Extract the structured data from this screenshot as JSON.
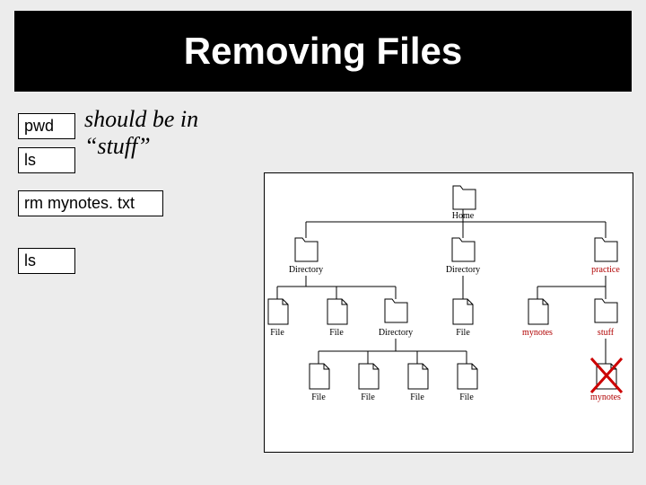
{
  "title": "Removing Files",
  "note_line1": "should be in",
  "note_line2": "“stuff”",
  "commands": {
    "c1": "pwd",
    "c2": "ls",
    "c3": "rm   mynotes. txt",
    "c4": "ls"
  },
  "tree": {
    "home": "Home",
    "dir1": "Directory",
    "dir2": "Directory",
    "practice": "practice",
    "file_a": "File",
    "file_b": "File",
    "dir3": "Directory",
    "file_c": "File",
    "mynotes1": "mynotes",
    "stuff": "stuff",
    "file_d": "File",
    "file_e": "File",
    "file_f": "File",
    "file_g": "File",
    "mynotes2": "mynotes"
  },
  "chart_data": {
    "type": "tree",
    "root": "Home",
    "children": [
      {
        "name": "Directory",
        "type": "folder",
        "children": [
          {
            "name": "File",
            "type": "file"
          },
          {
            "name": "File",
            "type": "file"
          },
          {
            "name": "Directory",
            "type": "folder",
            "children": [
              {
                "name": "File",
                "type": "file"
              },
              {
                "name": "File",
                "type": "file"
              },
              {
                "name": "File",
                "type": "file"
              },
              {
                "name": "File",
                "type": "file"
              }
            ]
          }
        ]
      },
      {
        "name": "Directory",
        "type": "folder",
        "children": [
          {
            "name": "File",
            "type": "file"
          }
        ]
      },
      {
        "name": "practice",
        "type": "folder",
        "color": "red",
        "children": [
          {
            "name": "mynotes",
            "type": "file",
            "color": "red"
          },
          {
            "name": "stuff",
            "type": "folder",
            "color": "red",
            "children": [
              {
                "name": "mynotes",
                "type": "file",
                "color": "red",
                "deleted": true
              }
            ]
          }
        ]
      }
    ]
  }
}
